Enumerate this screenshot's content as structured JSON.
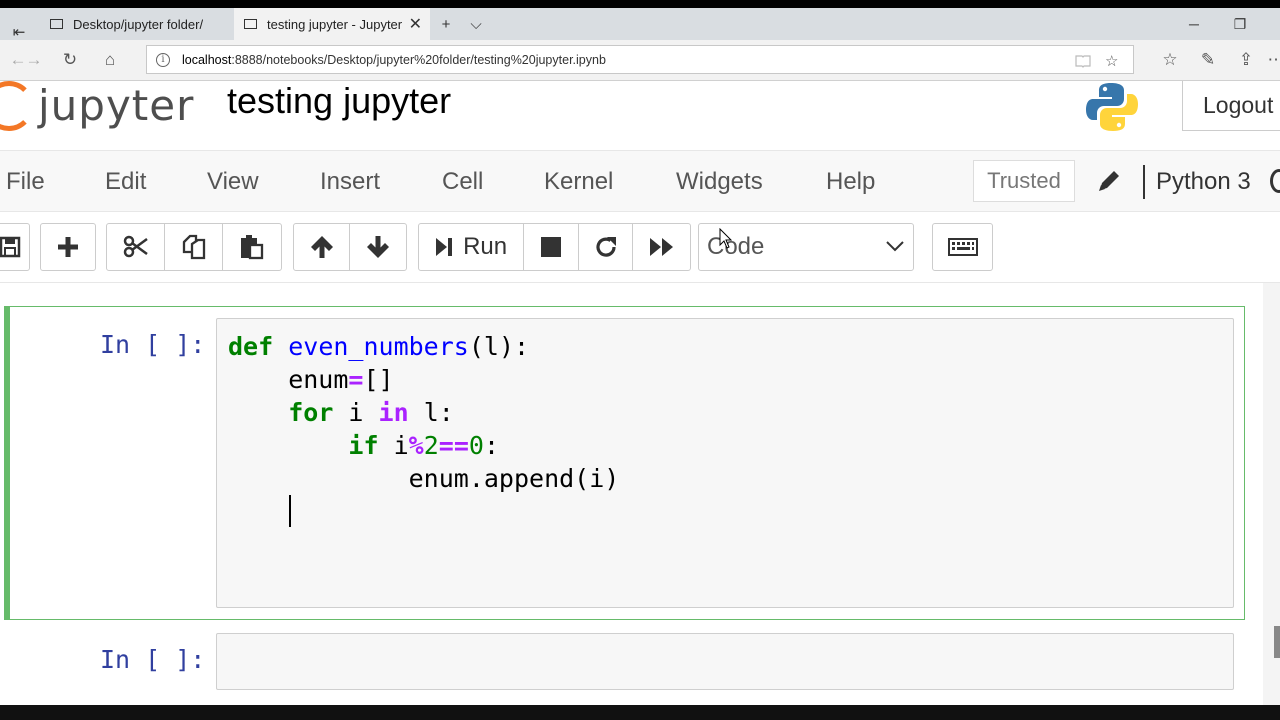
{
  "browser": {
    "tabs": [
      {
        "label": "Desktop/jupyter folder/",
        "active": false
      },
      {
        "label": "testing jupyter - Jupyter",
        "active": true
      }
    ],
    "url_host": "localhost",
    "url_rest": ":8888/notebooks/Desktop/jupyter%20folder/testing%20jupyter.ipynb",
    "new_tab_symbol": "+",
    "tab_list_symbol": "⌵",
    "close_symbol": "✕"
  },
  "header": {
    "logo_text": "jupyter",
    "notebook_title": "testing jupyter",
    "logout_label": "Logout"
  },
  "menubar": {
    "items": [
      "File",
      "Edit",
      "View",
      "Insert",
      "Cell",
      "Kernel",
      "Widgets",
      "Help"
    ],
    "trusted_label": "Trusted",
    "kernel_name": "Python 3"
  },
  "toolbar": {
    "run_label": "Run",
    "cell_type": "Code"
  },
  "cells": [
    {
      "prompt": "In [ ]:",
      "selected": true,
      "lines": [
        "def even_numbers(l):",
        "    enum=[]",
        "    for i in l:",
        "        if i%2==0:",
        "            enum.append(i)",
        "    "
      ]
    },
    {
      "prompt": "In [ ]:",
      "selected": false,
      "lines": []
    }
  ],
  "colors": {
    "jupyter_orange": "#f37726",
    "selected_cell_border": "#66bb6a",
    "prompt_blue": "#303f9f",
    "keyword_green": "#008000",
    "operator_purple": "#aa22ff"
  }
}
